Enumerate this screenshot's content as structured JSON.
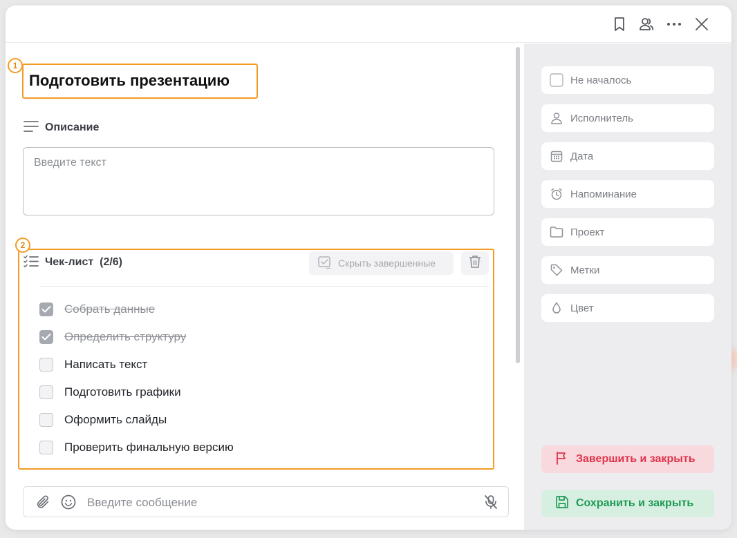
{
  "window": {
    "toolbar_icons": [
      "bookmark-icon",
      "users-icon",
      "more-icon",
      "close-icon"
    ]
  },
  "task": {
    "title": "Подготовить презентацию",
    "title_badge": "1",
    "description": {
      "label": "Описание",
      "placeholder": "Введите текст"
    },
    "checklist": {
      "badge": "2",
      "label": "Чек-лист",
      "count": "(2/6)",
      "hide_completed_label": "Скрыть завершенные",
      "items": [
        {
          "text": "Собрать данные",
          "done": true
        },
        {
          "text": "Определить структуру",
          "done": true
        },
        {
          "text": "Написать текст",
          "done": false
        },
        {
          "text": "Подготовить графики",
          "done": false
        },
        {
          "text": "Оформить слайды",
          "done": false
        },
        {
          "text": "Проверить финальную версию",
          "done": false
        }
      ]
    },
    "message": {
      "placeholder": "Введите сообщение"
    }
  },
  "sidebar": {
    "properties": [
      {
        "label": "Не началось",
        "icon": "status-checkbox-icon"
      },
      {
        "label": "Исполнитель",
        "icon": "person-icon"
      },
      {
        "label": "Дата",
        "icon": "calendar-icon"
      },
      {
        "label": "Напоминание",
        "icon": "alarm-icon"
      },
      {
        "label": "Проект",
        "icon": "folder-icon"
      },
      {
        "label": "Метки",
        "icon": "tag-icon"
      },
      {
        "label": "Цвет",
        "icon": "drop-icon"
      }
    ],
    "finish_label": "Завершить и закрыть",
    "save_label": "Сохранить и закрыть"
  },
  "colors": {
    "highlight": "#f59a23",
    "finish": "#e0344c",
    "save": "#1f9a55"
  }
}
